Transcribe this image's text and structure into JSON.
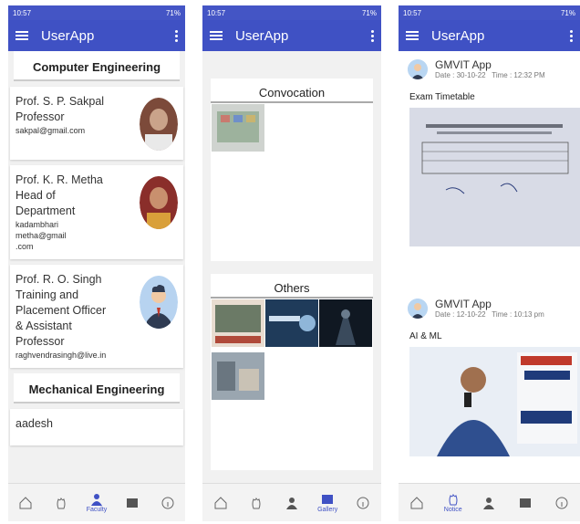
{
  "status": {
    "time": "10:57",
    "battery": "71%"
  },
  "app_title": "UserApp",
  "faculty": {
    "dept1": "Computer Engineering",
    "people": [
      {
        "name_lines": [
          "Prof. S. P. Sakpal",
          "Professor"
        ],
        "email": "sakpal@gmail.com"
      },
      {
        "name_lines": [
          "Prof. K. R. Metha",
          "Head of",
          "Department"
        ],
        "email_lines": [
          "kadambhari",
          "metha@gmail",
          ".com"
        ]
      },
      {
        "name_lines": [
          "Prof. R. O. Singh",
          "Training and",
          "Placement Officer",
          "& Assistant",
          "Professor"
        ],
        "email": "raghvendrasingh@live.in"
      }
    ],
    "dept2": "Mechanical Engineering",
    "partial_name": "aadesh"
  },
  "gallery": {
    "section1": "Convocation",
    "section2": "Others"
  },
  "notices": [
    {
      "app": "GMVIT App",
      "date": "Date : 30-10-22",
      "time": "Time : 12:32 PM",
      "text": "Exam Timetable"
    },
    {
      "app": "GMVIT App",
      "date": "Date : 12-10-22",
      "time": "Time : 10:13 pm",
      "text": "AI & ML"
    }
  ],
  "nav": {
    "faculty": "Faculty",
    "gallery": "Gallery",
    "notice": "Notice"
  },
  "colors": {
    "primary": "#3f51c4"
  }
}
